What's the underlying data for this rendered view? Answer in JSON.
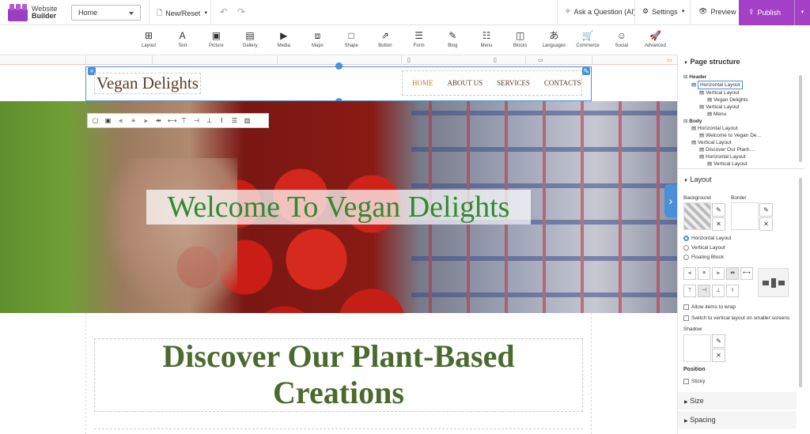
{
  "app": {
    "name_line1": "Website",
    "name_line2": "Builder"
  },
  "topbar": {
    "page_select": "Home",
    "new_reset": "New/Reset",
    "ask": "Ask a Question (AI)",
    "settings": "Settings",
    "preview": "Preview",
    "publish": "Publish"
  },
  "toolbar": [
    {
      "label": "Layout",
      "icon": "layout-icon",
      "glyph": "⊞"
    },
    {
      "label": "Text",
      "icon": "text-icon",
      "glyph": "A"
    },
    {
      "label": "Picture",
      "icon": "picture-icon",
      "glyph": "▣"
    },
    {
      "label": "Gallery",
      "icon": "gallery-icon",
      "glyph": "▤"
    },
    {
      "label": "Media",
      "icon": "media-icon",
      "glyph": "▶"
    },
    {
      "label": "Maps",
      "icon": "maps-icon",
      "glyph": "⧈"
    },
    {
      "label": "Shape",
      "icon": "shape-icon",
      "glyph": "□"
    },
    {
      "label": "Button",
      "icon": "button-icon",
      "glyph": "⇗"
    },
    {
      "label": "Form",
      "icon": "form-icon",
      "glyph": "☰"
    },
    {
      "label": "Blog",
      "icon": "blog-icon",
      "glyph": "✎"
    },
    {
      "label": "Menu",
      "icon": "menu-icon",
      "glyph": "☷"
    },
    {
      "label": "Blocks",
      "icon": "blocks-icon",
      "glyph": "◫"
    },
    {
      "label": "Languages",
      "icon": "languages-icon",
      "glyph": "あ"
    },
    {
      "label": "Commerce",
      "icon": "commerce-icon",
      "glyph": "🛒"
    },
    {
      "label": "Social",
      "icon": "social-icon",
      "glyph": "☺"
    },
    {
      "label": "Advanced",
      "icon": "advanced-icon",
      "glyph": "🚀"
    }
  ],
  "site": {
    "brand": "Vegan Delights",
    "nav": [
      "HOME",
      "ABOUT US",
      "SERVICES",
      "CONTACTS"
    ],
    "hero_title": "Welcome To Vegan Delights",
    "section_title": "Discover Our Plant-Based Creations"
  },
  "panel": {
    "page_structure": "Page structure",
    "tree": [
      {
        "label": "Header",
        "depth": 0
      },
      {
        "label": "Horizontal Layout",
        "depth": 1,
        "selected": true
      },
      {
        "label": "Vertical Layout",
        "depth": 2
      },
      {
        "label": "Vegan Delights",
        "depth": 3
      },
      {
        "label": "Vertical Layout",
        "depth": 2
      },
      {
        "label": "Menu",
        "depth": 3
      },
      {
        "label": "Body",
        "depth": 0
      },
      {
        "label": "Horizontal Layout",
        "depth": 1
      },
      {
        "label": "Welcome to Vegan De...",
        "depth": 2
      },
      {
        "label": "Vertical Layout",
        "depth": 1
      },
      {
        "label": "Discover Our Plant-...",
        "depth": 2
      },
      {
        "label": "Horizontal Layout",
        "depth": 2
      },
      {
        "label": "Vertical Layout",
        "depth": 3
      }
    ],
    "layout": "Layout",
    "background": "Background",
    "border": "Border",
    "opt_horizontal": "Horizontal Layout",
    "opt_vertical": "Vertical Layout",
    "opt_floating": "Floating Block",
    "allow_wrap": "Allow items to wrap",
    "switch_vertical": "Switch to vertical layout on smaller screens",
    "shadow": "Shadow",
    "position": "Position",
    "sticky": "Sticky",
    "size": "Size",
    "spacing": "Spacing"
  }
}
